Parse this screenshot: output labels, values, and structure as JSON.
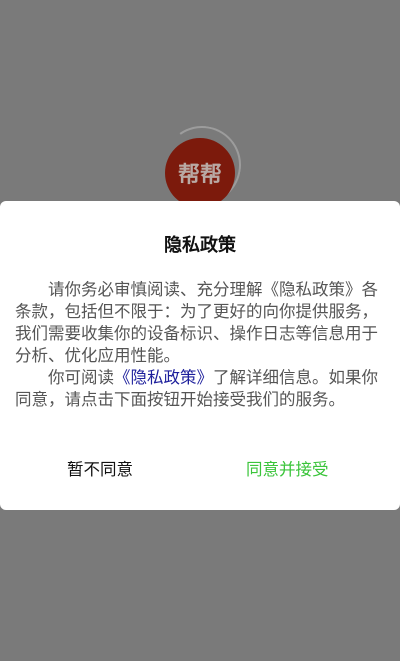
{
  "background": {
    "logo_text": "帮帮",
    "logo_color": "#7c1a0c",
    "overlay_color": "#7a7a7a"
  },
  "dialog": {
    "title": "隐私政策",
    "paragraph1": "请你务必审慎阅读、充分理解《隐私政策》各条款，包括但不限于：为了更好的向你提供服务，我们需要收集你的设备标识、操作日志等信息用于分析、优化应用性能。",
    "paragraph2_prefix": "你可阅读",
    "policy_link": "《隐私政策》",
    "paragraph2_suffix": "了解详细信息。如果你同意，请点击下面按钮开始接受我们的服务。",
    "decline_label": "暂不同意",
    "accept_label": "同意并接受",
    "link_color": "#1d1f9c",
    "accept_color": "#3ac43a"
  }
}
